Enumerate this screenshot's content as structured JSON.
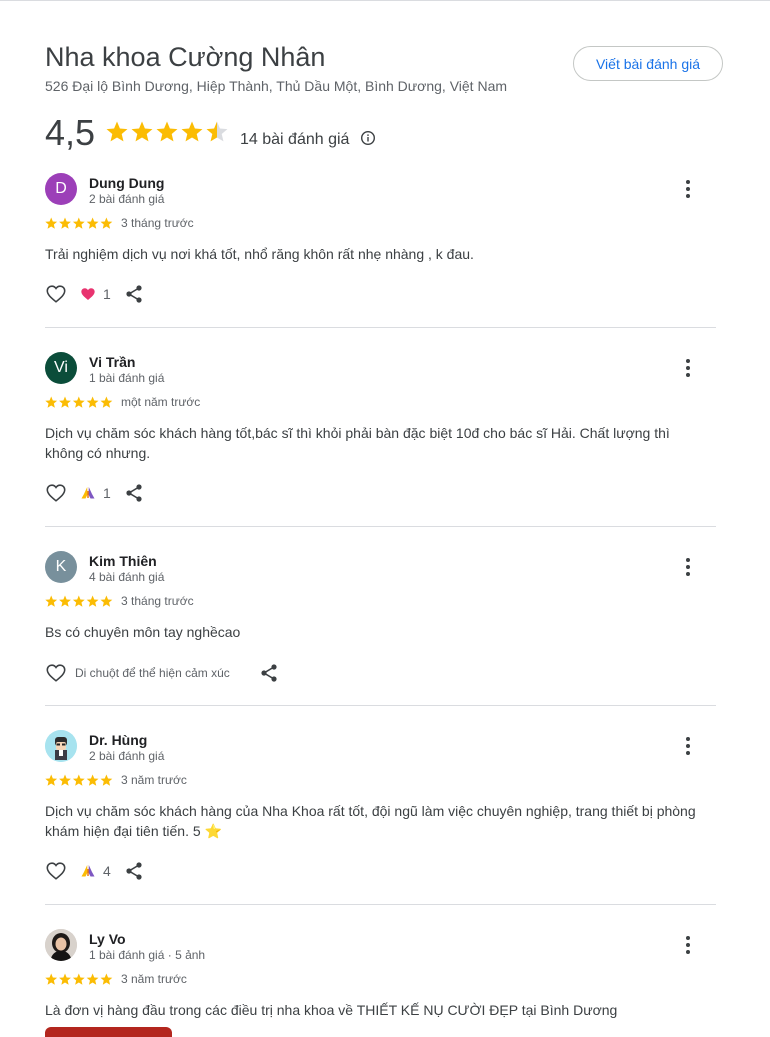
{
  "business": {
    "name": "Nha khoa Cường Nhân",
    "address": "526 Đại lộ Bình Dương, Hiệp Thành, Thủ Dầu Một, Bình Dương, Việt Nam",
    "write_review_label": "Viết bài đánh giá",
    "rating": "4,5",
    "rating_value": 4.5,
    "review_count_label": "14 bài đánh giá"
  },
  "colors": {
    "star": "#fbbc04",
    "star_empty": "#dadce0",
    "accent": "#1a73e8"
  },
  "icons": [
    "info-icon",
    "star-icon",
    "more-vert-icon",
    "heart-outline-icon",
    "share-icon",
    "heart-reaction-icon",
    "praise-hands-reaction-icon"
  ],
  "reviews": [
    {
      "initial": "D",
      "avatar_color": "#9c3fb8",
      "name": "Dung Dung",
      "meta": "2 bài đánh giá",
      "stars": 5,
      "time": "3 tháng trước",
      "text": "Trải nghiệm dịch vụ nơi khá tốt, nhổ răng khôn rất nhẹ nhàng , k đau.",
      "reaction": "heart-reaction-icon",
      "reaction_count": "1"
    },
    {
      "initial": "Vi",
      "avatar_color": "#0b4d3a",
      "name": "Vi Trần",
      "meta": "1 bài đánh giá",
      "stars": 5,
      "time": "một năm trước",
      "text": "Dịch vụ chăm sóc khách hàng tốt,bác sĩ thì khỏi phải bàn đặc biệt 10đ cho bác sĩ Hải. Chất lượng thì không có nhưng.",
      "reaction": "praise-hands-reaction-icon",
      "reaction_count": "1"
    },
    {
      "initial": "K",
      "avatar_color": "#78909c",
      "name": "Kim Thiên",
      "meta": "4 bài đánh giá",
      "stars": 5,
      "time": "3 tháng trước",
      "text": "Bs có chuyên môn tay nghềcao",
      "hover_hint": "Di chuột để thể hiện cảm xúc"
    },
    {
      "initial": "",
      "avatar_color": "#a7e3ef",
      "name": "Dr. Hùng",
      "meta": "2 bài đánh giá",
      "stars": 5,
      "time": "3 năm trước",
      "text": "Dịch vụ chăm sóc khách hàng của Nha Khoa rất tốt, đội ngũ làm việc chuyên nghiệp, trang thiết bị phòng khám hiện đại tiên tiến. 5 ⭐",
      "reaction": "praise-hands-reaction-icon",
      "reaction_count": "4"
    },
    {
      "initial": "",
      "avatar_color": "#cfc7c2",
      "name": "Ly Vo",
      "meta": "1 bài đánh giá · 5 ảnh",
      "stars": 5,
      "time": "3 năm trước",
      "text": "Là đơn vị hàng đầu trong các điều trị nha khoa về THIẾT KẾ NỤ CƯỜI ĐẸP tại Bình Dương"
    }
  ]
}
